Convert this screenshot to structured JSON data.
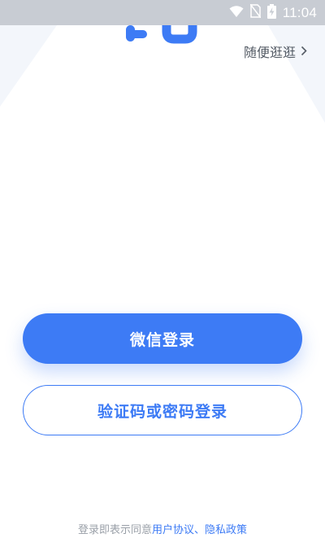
{
  "status_bar": {
    "time": "11:04",
    "icons": [
      "wifi-icon",
      "no-sim-icon",
      "battery-charging-icon"
    ]
  },
  "header": {
    "logo": "logo-mark",
    "browse_label": "随便逛逛",
    "browse_icon": "chevron-right-icon"
  },
  "login": {
    "wechat_label": "微信登录",
    "code_password_label": "验证码或密码登录"
  },
  "agreement": {
    "prefix": "登录即表示同意",
    "user_agreement": "用户协议",
    "separator": "、",
    "privacy_policy": "隐私政策"
  },
  "colors": {
    "accent": "#3d7bf5",
    "status_bar": "#c8ccd3",
    "muted_text": "#9aa0a8"
  }
}
